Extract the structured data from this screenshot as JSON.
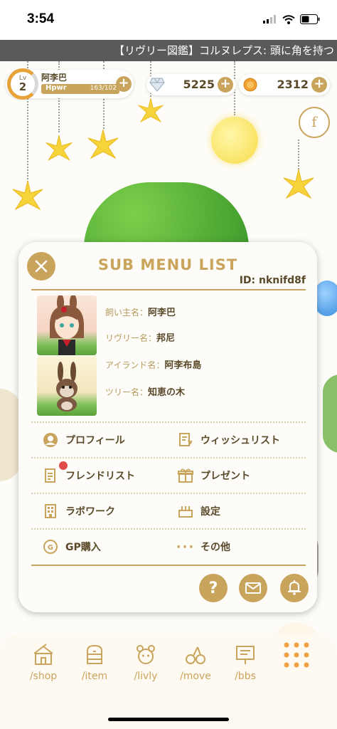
{
  "status": {
    "time": "3:54"
  },
  "ticker": {
    "text": "【リヴリー図鑑】コルヌレプス: 頭に角を持つ"
  },
  "player": {
    "level_label": "Lv",
    "level": "2",
    "name": "阿李巴",
    "hpwr_label": "Hpwr",
    "hpwr_value": "163/102",
    "hpwr_fraction": 1.0
  },
  "currency": {
    "diamonds": "5225",
    "coins": "2312"
  },
  "social_button_label": "f",
  "modal": {
    "title": "SUB MENU LIST",
    "id_text": "ID: nknifd8f",
    "info": [
      {
        "label": "飼い主名：",
        "value": "阿李巴"
      },
      {
        "label": "リヴリー名：",
        "value": "邦尼"
      },
      {
        "label": "アイランド名：",
        "value": "阿李布島"
      },
      {
        "label": "ツリー名：",
        "value": "知恵の木"
      }
    ],
    "menu": [
      {
        "label": "プロフィール",
        "icon": "profile-icon"
      },
      {
        "label": "ウィッシュリスト",
        "icon": "wishlist-icon"
      },
      {
        "label": "フレンドリスト",
        "icon": "friendlist-icon"
      },
      {
        "label": "プレゼント",
        "icon": "present-icon"
      },
      {
        "label": "ラボワーク",
        "icon": "labwork-icon"
      },
      {
        "label": "設定",
        "icon": "settings-icon"
      },
      {
        "label": "GP購入",
        "icon": "gp-coin-icon"
      },
      {
        "label": "その他",
        "icon": "more-dots-icon"
      }
    ],
    "round_buttons": {
      "help": "?",
      "mail_icon": "mail-icon",
      "notice_icon": "bell-icon"
    }
  },
  "nav": [
    {
      "label": "/shop",
      "icon": "shop-icon"
    },
    {
      "label": "/item",
      "icon": "item-icon"
    },
    {
      "label": "/livly",
      "icon": "livly-icon"
    },
    {
      "label": "/move",
      "icon": "move-icon"
    },
    {
      "label": "/bbs",
      "icon": "bbs-icon"
    }
  ],
  "colors": {
    "accent_gold": "#c9a45c",
    "text_brown": "#5a4a2a",
    "notify_red": "#e04a4a",
    "nav_orange": "#f0a040"
  }
}
